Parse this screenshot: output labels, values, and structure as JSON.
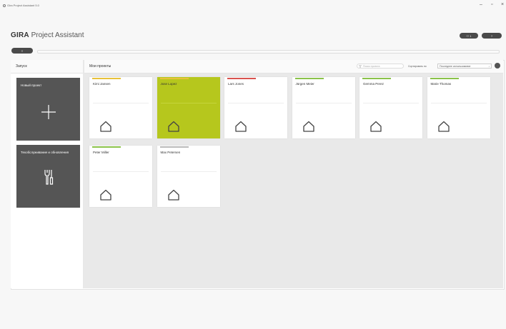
{
  "window": {
    "title": "Gira Project Assistant 5.0",
    "controls": {
      "minimize": "–",
      "maximize": "▫",
      "close": "×"
    }
  },
  "brand": {
    "name": "GIRA",
    "product": "Project Assistant"
  },
  "header_buttons": {
    "user": "⚇ 1",
    "help": "?"
  },
  "menu_button": "≡",
  "left": {
    "title": "Запуск",
    "tiles": [
      {
        "label": "Новый проект",
        "icon": "plus-icon"
      },
      {
        "label": "Техобслуживание и обновления",
        "icon": "wrench-screwdriver-icon"
      }
    ]
  },
  "projects": {
    "title": "Мои проекты",
    "search_placeholder": "Поиск проекта",
    "sort_label": "Сортировать по",
    "sort_value": "Последнее использование",
    "sort_arrow": "↓",
    "items": [
      {
        "name": "Kimi Jansen",
        "color": "#e8c23a",
        "icon": "house-icon",
        "active": false
      },
      {
        "name": "Jose Lopez",
        "color": "#e8c23a",
        "icon": "house-icon",
        "active": true
      },
      {
        "name": "Lars Jones",
        "color": "#d9534f",
        "icon": "house-icon",
        "active": false
      },
      {
        "name": "Jürgen Meier",
        "color": "#8bc34a",
        "icon": "house-icon",
        "active": false
      },
      {
        "name": "Gemma Perez",
        "color": "#8bc34a",
        "icon": "house-icon",
        "active": false
      },
      {
        "name": "Marie Thomas",
        "color": "#8bc34a",
        "icon": "house-icon",
        "active": false
      },
      {
        "name": "Peter Miller",
        "color": "#8bc34a",
        "icon": "house-icon",
        "active": false
      },
      {
        "name": "Max Petersen",
        "color": "#bbbbbb",
        "icon": "house-icon",
        "active": false
      }
    ]
  }
}
